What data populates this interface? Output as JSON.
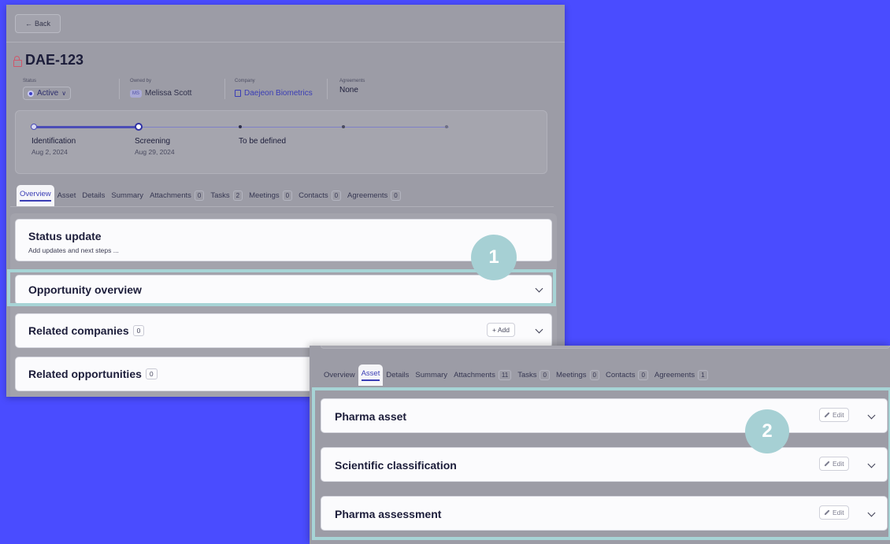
{
  "panel1": {
    "back_label": "Back",
    "title": "DAE-123",
    "meta": {
      "status_label": "Status",
      "status_value": "Active",
      "owner_label": "Owned by",
      "owner_initials": "MS",
      "owner_value": "Melissa Scott",
      "company_label": "Company",
      "company_value": "Daejeon Biometrics",
      "agreements_label": "Agreements",
      "agreements_value": "None"
    },
    "timeline": [
      {
        "label": "Identification",
        "date": "Aug 2, 2024"
      },
      {
        "label": "Screening",
        "date": "Aug 29, 2024"
      },
      {
        "label": "To be defined",
        "date": ""
      }
    ],
    "tabs": [
      {
        "label": "Overview",
        "count": null
      },
      {
        "label": "Asset",
        "count": null
      },
      {
        "label": "Details",
        "count": null
      },
      {
        "label": "Summary",
        "count": null
      },
      {
        "label": "Attachments",
        "count": "0"
      },
      {
        "label": "Tasks",
        "count": "2"
      },
      {
        "label": "Meetings",
        "count": "0"
      },
      {
        "label": "Contacts",
        "count": "0"
      },
      {
        "label": "Agreements",
        "count": "0"
      }
    ],
    "cards": {
      "status_update_title": "Status update",
      "status_update_sub": "Add updates and next steps ...",
      "opportunity_overview_title": "Opportunity overview",
      "related_companies_title": "Related companies",
      "related_companies_count": "0",
      "add_label": "+ Add",
      "related_opportunities_title": "Related opportunities",
      "related_opportunities_count": "0"
    },
    "callout_number": "1"
  },
  "panel2": {
    "tabs": [
      {
        "label": "Overview",
        "count": null
      },
      {
        "label": "Asset",
        "count": null
      },
      {
        "label": "Details",
        "count": null
      },
      {
        "label": "Summary",
        "count": null
      },
      {
        "label": "Attachments",
        "count": "11"
      },
      {
        "label": "Tasks",
        "count": "0"
      },
      {
        "label": "Meetings",
        "count": "0"
      },
      {
        "label": "Contacts",
        "count": "0"
      },
      {
        "label": "Agreements",
        "count": "1"
      }
    ],
    "cards": {
      "pharma_asset_title": "Pharma asset",
      "scientific_classification_title": "Scientific classification",
      "pharma_assessment_title": "Pharma assessment",
      "edit_label": "Edit"
    },
    "callout_number": "2"
  },
  "colors": {
    "background": "#4a4cff",
    "accent": "#3a3db5",
    "highlight": "#a7d4d6"
  }
}
